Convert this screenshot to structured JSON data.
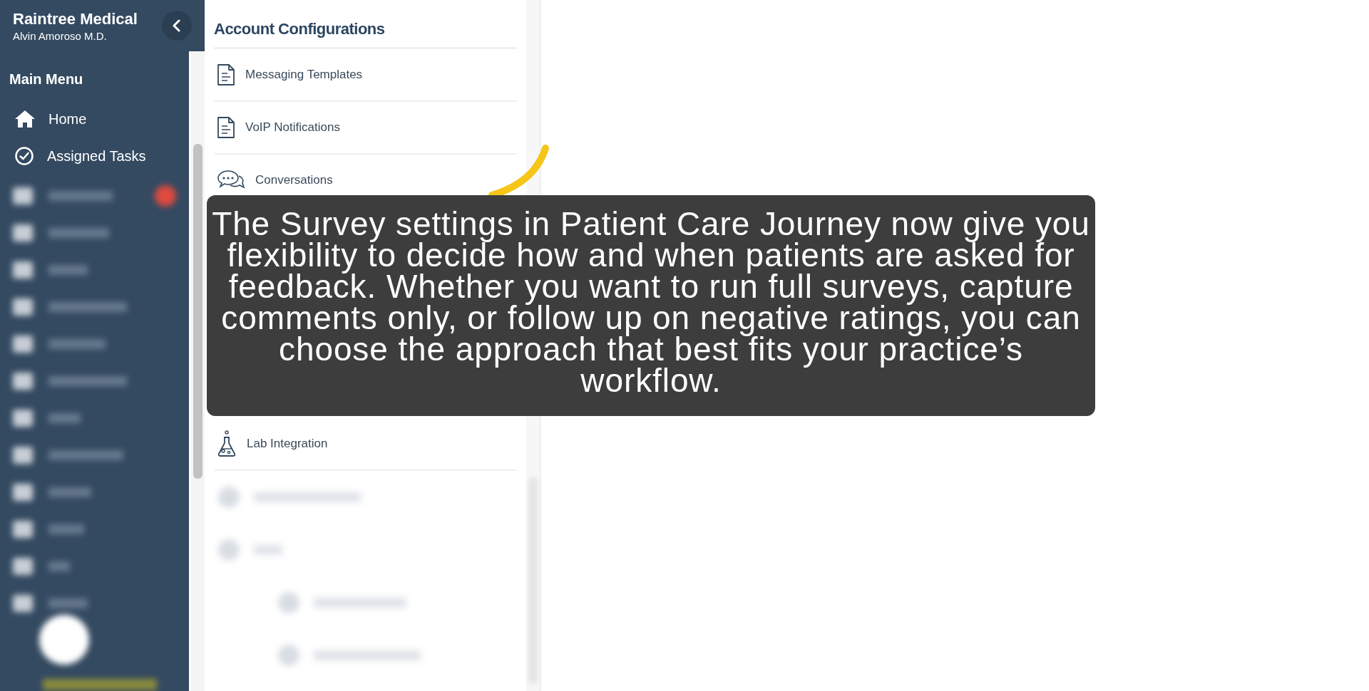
{
  "sidebar": {
    "brand": "Raintree Medical",
    "user": "Alvin Amoroso M.D.",
    "menu_title": "Main Menu",
    "items": [
      {
        "label": "Home"
      },
      {
        "label": "Assigned Tasks"
      }
    ]
  },
  "settings_panel": {
    "title": "Account Configurations",
    "items": [
      {
        "label": "Messaging Templates"
      },
      {
        "label": "VoIP Notifications"
      },
      {
        "label": "Conversations"
      },
      {
        "label": "Lab Integration"
      }
    ]
  },
  "tutorial": {
    "caption": "The Survey settings in Patient Care Journey now give you flexibility to decide how and when patients are asked for feedback. Whether you want to run full surveys, capture comments only, or follow up on negative ratings, you can choose the approach that best fits your practice’s workflow."
  }
}
